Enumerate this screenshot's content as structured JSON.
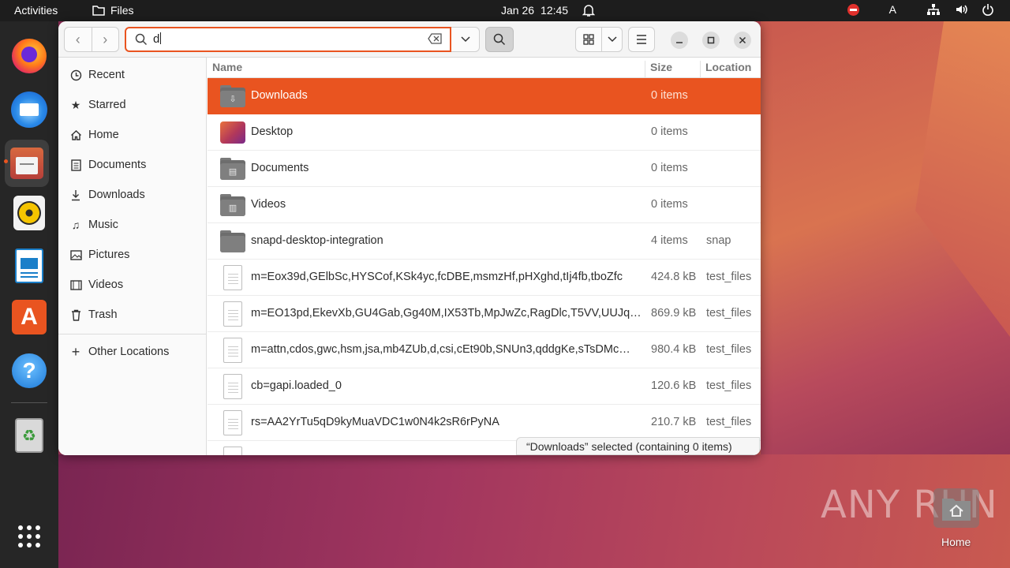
{
  "topbar": {
    "activities": "Activities",
    "app_name": "Files",
    "date": "Jan 26",
    "time": "12:45",
    "input_indicator": "A"
  },
  "dock": {
    "items": [
      {
        "name": "firefox",
        "icon": "firefox-icon"
      },
      {
        "name": "thunderbird",
        "icon": "thunderbird-icon"
      },
      {
        "name": "files",
        "icon": "files-icon",
        "active": true
      },
      {
        "name": "rhythmbox",
        "icon": "rhythmbox-icon"
      },
      {
        "name": "libreoffice-writer",
        "icon": "writer-icon"
      },
      {
        "name": "app-center",
        "icon": "app-center-icon"
      },
      {
        "name": "help",
        "icon": "help-icon"
      },
      {
        "name": "trash",
        "icon": "trash-icon"
      },
      {
        "name": "show-apps",
        "icon": "app-grid-icon"
      }
    ]
  },
  "search": {
    "value": "d"
  },
  "sidebar": {
    "items": [
      {
        "label": "Recent",
        "icon": "clock-icon"
      },
      {
        "label": "Starred",
        "icon": "star-icon"
      },
      {
        "label": "Home",
        "icon": "home-icon"
      },
      {
        "label": "Documents",
        "icon": "document-icon"
      },
      {
        "label": "Downloads",
        "icon": "download-icon"
      },
      {
        "label": "Music",
        "icon": "music-icon"
      },
      {
        "label": "Pictures",
        "icon": "picture-icon"
      },
      {
        "label": "Videos",
        "icon": "video-icon"
      },
      {
        "label": "Trash",
        "icon": "trash-icon"
      },
      {
        "label": "Other Locations",
        "icon": "plus-icon"
      }
    ]
  },
  "columns": {
    "name": "Name",
    "size": "Size",
    "location": "Location"
  },
  "files": [
    {
      "name": "Downloads",
      "size": "0 items",
      "location": "",
      "type": "folder",
      "emblem": "download-icon",
      "selected": true
    },
    {
      "name": "Desktop",
      "size": "0 items",
      "location": "",
      "type": "desktop-folder"
    },
    {
      "name": "Documents",
      "size": "0 items",
      "location": "",
      "type": "folder",
      "emblem": "document-icon"
    },
    {
      "name": "Videos",
      "size": "0 items",
      "location": "",
      "type": "folder",
      "emblem": "video-icon"
    },
    {
      "name": "snapd-desktop-integration",
      "size": "4 items",
      "location": "snap",
      "type": "folder"
    },
    {
      "name": "m=Eox39d,GElbSc,HYSCof,KSk4yc,fcDBE,msmzHf,pHXghd,tIj4fb,tboZfc",
      "size": "424.8 kB",
      "location": "test_files",
      "type": "file"
    },
    {
      "name": "m=EO13pd,EkevXb,GU4Gab,Gg40M,IX53Tb,MpJwZc,RagDlc,T5VV,UUJq…",
      "size": "869.9 kB",
      "location": "test_files",
      "type": "file"
    },
    {
      "name": "m=attn,cdos,gwc,hsm,jsa,mb4ZUb,d,csi,cEt90b,SNUn3,qddgKe,sTsDMc…",
      "size": "980.4 kB",
      "location": "test_files",
      "type": "file"
    },
    {
      "name": "cb=gapi.loaded_0",
      "size": "120.6 kB",
      "location": "test_files",
      "type": "file"
    },
    {
      "name": "rs=AA2YrTu5qD9kyMuaVDC1w0N4k2sR6rPyNA",
      "size": "210.7 kB",
      "location": "test_files",
      "type": "file"
    }
  ],
  "status": "“Downloads” selected  (containing 0 items)",
  "desktop": {
    "home_label": "Home",
    "watermark": "ANY RUN"
  },
  "colors": {
    "accent": "#e95420",
    "topbar": "#1d1d1d",
    "dock": "#262626"
  }
}
